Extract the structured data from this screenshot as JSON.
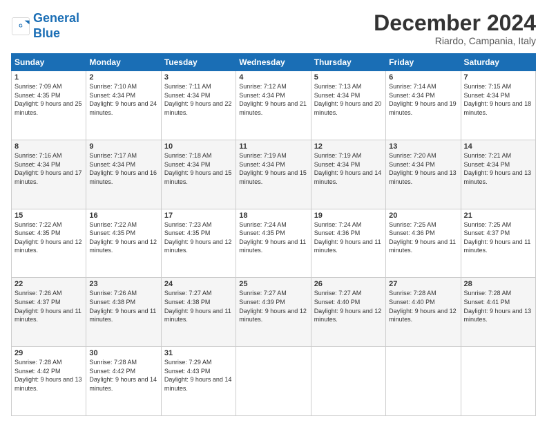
{
  "header": {
    "logo_line1": "General",
    "logo_line2": "Blue",
    "month_title": "December 2024",
    "location": "Riardo, Campania, Italy"
  },
  "days_of_week": [
    "Sunday",
    "Monday",
    "Tuesday",
    "Wednesday",
    "Thursday",
    "Friday",
    "Saturday"
  ],
  "weeks": [
    [
      {
        "day": "1",
        "sunrise": "7:09 AM",
        "sunset": "4:35 PM",
        "daylight": "9 hours and 25 minutes."
      },
      {
        "day": "2",
        "sunrise": "7:10 AM",
        "sunset": "4:34 PM",
        "daylight": "9 hours and 24 minutes."
      },
      {
        "day": "3",
        "sunrise": "7:11 AM",
        "sunset": "4:34 PM",
        "daylight": "9 hours and 22 minutes."
      },
      {
        "day": "4",
        "sunrise": "7:12 AM",
        "sunset": "4:34 PM",
        "daylight": "9 hours and 21 minutes."
      },
      {
        "day": "5",
        "sunrise": "7:13 AM",
        "sunset": "4:34 PM",
        "daylight": "9 hours and 20 minutes."
      },
      {
        "day": "6",
        "sunrise": "7:14 AM",
        "sunset": "4:34 PM",
        "daylight": "9 hours and 19 minutes."
      },
      {
        "day": "7",
        "sunrise": "7:15 AM",
        "sunset": "4:34 PM",
        "daylight": "9 hours and 18 minutes."
      }
    ],
    [
      {
        "day": "8",
        "sunrise": "7:16 AM",
        "sunset": "4:34 PM",
        "daylight": "9 hours and 17 minutes."
      },
      {
        "day": "9",
        "sunrise": "7:17 AM",
        "sunset": "4:34 PM",
        "daylight": "9 hours and 16 minutes."
      },
      {
        "day": "10",
        "sunrise": "7:18 AM",
        "sunset": "4:34 PM",
        "daylight": "9 hours and 15 minutes."
      },
      {
        "day": "11",
        "sunrise": "7:19 AM",
        "sunset": "4:34 PM",
        "daylight": "9 hours and 15 minutes."
      },
      {
        "day": "12",
        "sunrise": "7:19 AM",
        "sunset": "4:34 PM",
        "daylight": "9 hours and 14 minutes."
      },
      {
        "day": "13",
        "sunrise": "7:20 AM",
        "sunset": "4:34 PM",
        "daylight": "9 hours and 13 minutes."
      },
      {
        "day": "14",
        "sunrise": "7:21 AM",
        "sunset": "4:34 PM",
        "daylight": "9 hours and 13 minutes."
      }
    ],
    [
      {
        "day": "15",
        "sunrise": "7:22 AM",
        "sunset": "4:35 PM",
        "daylight": "9 hours and 12 minutes."
      },
      {
        "day": "16",
        "sunrise": "7:22 AM",
        "sunset": "4:35 PM",
        "daylight": "9 hours and 12 minutes."
      },
      {
        "day": "17",
        "sunrise": "7:23 AM",
        "sunset": "4:35 PM",
        "daylight": "9 hours and 12 minutes."
      },
      {
        "day": "18",
        "sunrise": "7:24 AM",
        "sunset": "4:35 PM",
        "daylight": "9 hours and 11 minutes."
      },
      {
        "day": "19",
        "sunrise": "7:24 AM",
        "sunset": "4:36 PM",
        "daylight": "9 hours and 11 minutes."
      },
      {
        "day": "20",
        "sunrise": "7:25 AM",
        "sunset": "4:36 PM",
        "daylight": "9 hours and 11 minutes."
      },
      {
        "day": "21",
        "sunrise": "7:25 AM",
        "sunset": "4:37 PM",
        "daylight": "9 hours and 11 minutes."
      }
    ],
    [
      {
        "day": "22",
        "sunrise": "7:26 AM",
        "sunset": "4:37 PM",
        "daylight": "9 hours and 11 minutes."
      },
      {
        "day": "23",
        "sunrise": "7:26 AM",
        "sunset": "4:38 PM",
        "daylight": "9 hours and 11 minutes."
      },
      {
        "day": "24",
        "sunrise": "7:27 AM",
        "sunset": "4:38 PM",
        "daylight": "9 hours and 11 minutes."
      },
      {
        "day": "25",
        "sunrise": "7:27 AM",
        "sunset": "4:39 PM",
        "daylight": "9 hours and 12 minutes."
      },
      {
        "day": "26",
        "sunrise": "7:27 AM",
        "sunset": "4:40 PM",
        "daylight": "9 hours and 12 minutes."
      },
      {
        "day": "27",
        "sunrise": "7:28 AM",
        "sunset": "4:40 PM",
        "daylight": "9 hours and 12 minutes."
      },
      {
        "day": "28",
        "sunrise": "7:28 AM",
        "sunset": "4:41 PM",
        "daylight": "9 hours and 13 minutes."
      }
    ],
    [
      {
        "day": "29",
        "sunrise": "7:28 AM",
        "sunset": "4:42 PM",
        "daylight": "9 hours and 13 minutes."
      },
      {
        "day": "30",
        "sunrise": "7:28 AM",
        "sunset": "4:42 PM",
        "daylight": "9 hours and 14 minutes."
      },
      {
        "day": "31",
        "sunrise": "7:29 AM",
        "sunset": "4:43 PM",
        "daylight": "9 hours and 14 minutes."
      },
      null,
      null,
      null,
      null
    ]
  ],
  "labels": {
    "sunrise": "Sunrise:",
    "sunset": "Sunset:",
    "daylight": "Daylight:"
  }
}
